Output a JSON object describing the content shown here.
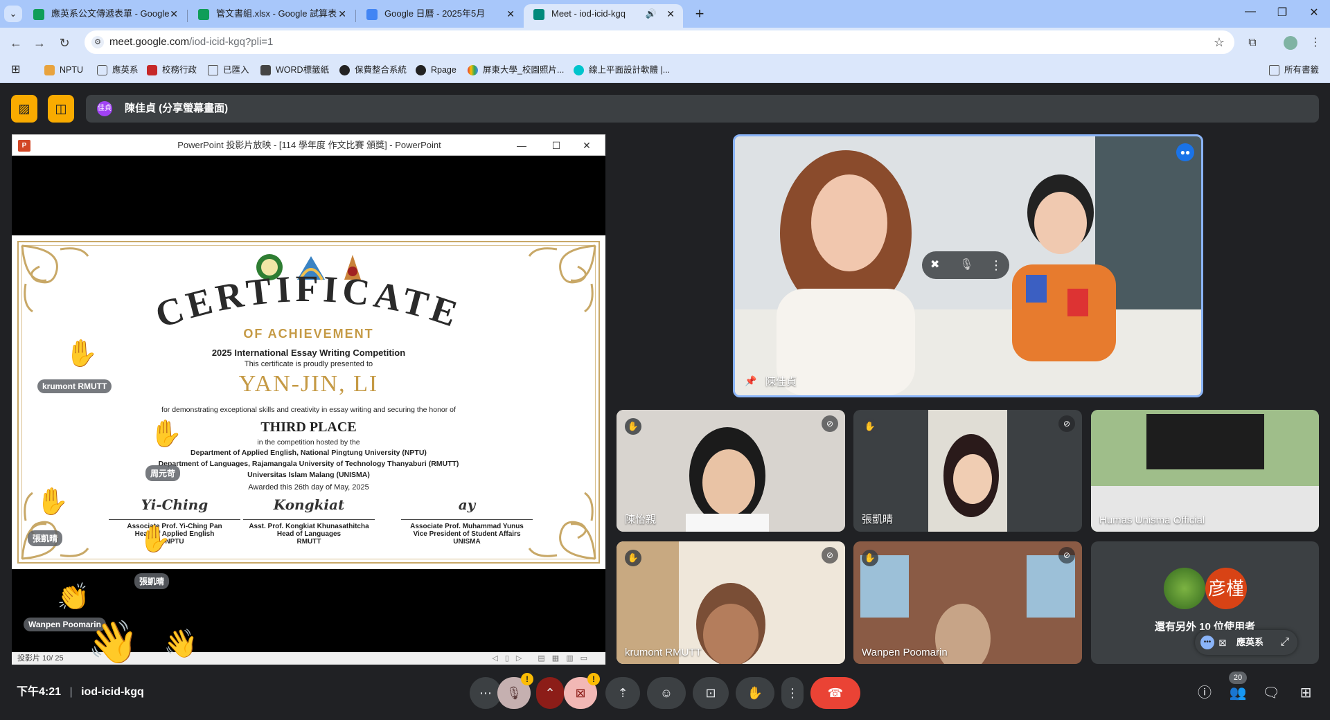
{
  "browser": {
    "tabs": [
      {
        "title": "應英系公文傳遞表單 - Google",
        "favicon_color": "#0f9d58"
      },
      {
        "title": "管文書組.xlsx - Google 試算表",
        "favicon_color": "#0f9d58"
      },
      {
        "title": "Google 日曆 - 2025年5月",
        "favicon_color": "#4285f4"
      },
      {
        "title": "Meet - iod-icid-kgq",
        "favicon_color": "#00897b"
      }
    ],
    "url_main": "meet.google.com",
    "url_rest": "/iod-icid-kgq?pli=1",
    "bookmarks": [
      {
        "label": "NPTU",
        "color": "#e8a33d"
      },
      {
        "label": "應英系",
        "color": "#ffffff"
      },
      {
        "label": "校務行政",
        "color": "#c62828"
      },
      {
        "label": "已匯入",
        "color": "#ffffff"
      },
      {
        "label": "WORD標籤紙",
        "color": "#444444"
      },
      {
        "label": "保費整合系統",
        "color": "#222222"
      },
      {
        "label": "Rpage",
        "color": "#222222"
      },
      {
        "label": "屏東大學_校園照片...",
        "color": "#e53935"
      },
      {
        "label": "線上平面設計軟體 |...",
        "color": "#00c4cc"
      }
    ],
    "all_bookmarks": "所有書籤"
  },
  "meet": {
    "presenter_initials": "佳貞",
    "presenter_label": "陳佳貞 (分享螢幕畫面)",
    "ppt": {
      "caption": "PowerPoint 投影片放映 - [114 學年度 作文比賽 頒獎] - PowerPoint",
      "slide_no": "投影片 10/ 25"
    },
    "certificate": {
      "title": "CERTIFICATE",
      "subtitle": "OF ACHIEVEMENT",
      "competition": "2025 International Essay Writing Competition",
      "presented": "This certificate is proudly presented to",
      "recipient": "YAN-JIN, LI",
      "for_text": "for demonstrating exceptional skills and creativity in essay writing and securing the honor of",
      "place": "THIRD PLACE",
      "hosted": "in the competition hosted by the",
      "host1": "Department of Applied English, National Pingtung University (NPTU)",
      "host2": "Department of Languages, Rajamangala University of Technology Thanyaburi (RMUTT)",
      "host3": "Universitas Islam Malang (UNISMA)",
      "awarded": "Awarded this 26th day of May, 2025",
      "signatures": [
        {
          "scrawl": "Yi-Ching",
          "l1": "Associate Prof. Yi-Ching Pan",
          "l2": "Head of Applied English",
          "l3": "NPTU"
        },
        {
          "scrawl": "Kongkiat",
          "l1": "Asst. Prof. Kongkiat Khunasathitcha",
          "l2": "Head of Languages",
          "l3": "RMUTT"
        },
        {
          "scrawl": "ay",
          "l1": "Associate Prof. Muhammad Yunus",
          "l2": "Vice President of Student Affairs",
          "l3": "UNISMA"
        }
      ]
    },
    "reaction_names": [
      "krumont RMUTT",
      "周元苛",
      "張凱晴",
      "張凱晴",
      "Wanpen Poomarin"
    ],
    "tiles": {
      "main": "陳佳貞",
      "t1": "陳怡親",
      "t2": "張凱晴",
      "t3": "Humas Unisma Official",
      "t4": "krumont RMUTT",
      "t5": "Wanpen Poomarin",
      "others_avatar": "彦槿",
      "others_text": "還有另外 10 位使用者",
      "others_account": "應英系"
    },
    "time": "下午4:21",
    "meeting_code": "iod-icid-kgq",
    "participant_count": "20"
  }
}
